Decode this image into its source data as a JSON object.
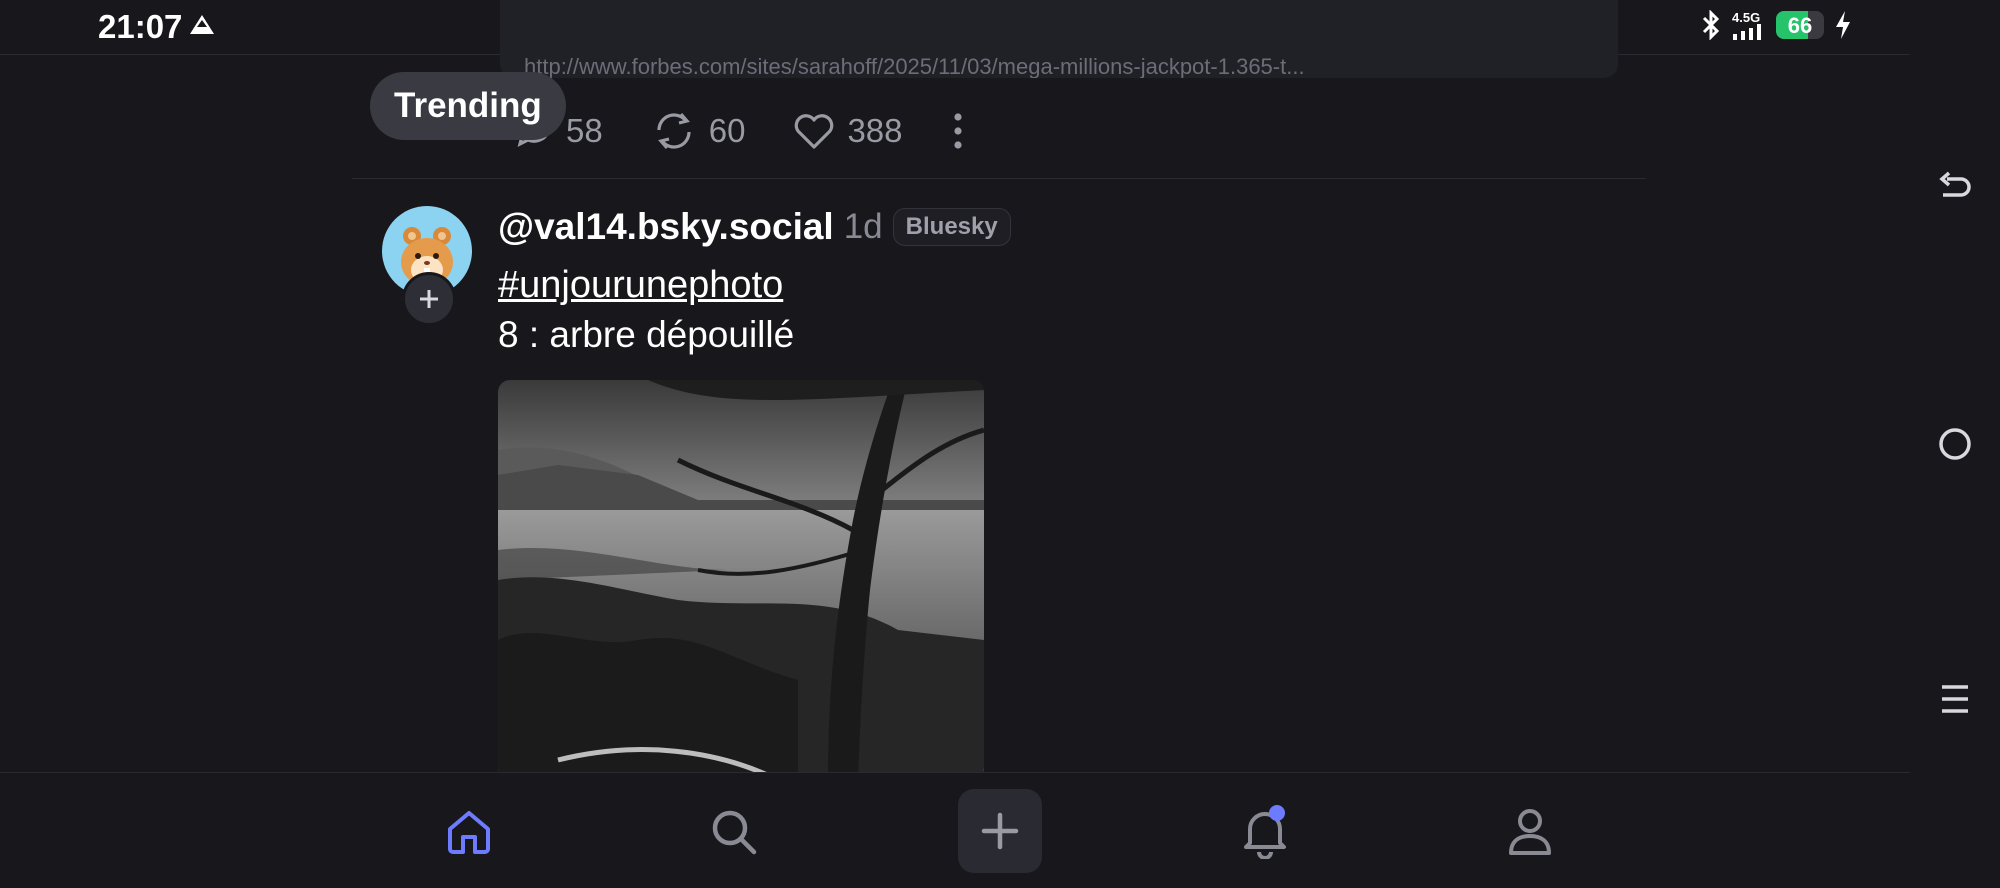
{
  "status_bar": {
    "time": "21:07",
    "network": "4.5G",
    "battery_level": "66",
    "battery_fraction": 0.66,
    "battery_color": "#25c36a"
  },
  "previous_post": {
    "link_url": "http://www.forbes.com/sites/sarahoff/2025/11/03/mega-millions-jackpot-1.365-t...",
    "replies": "58",
    "reposts": "60",
    "likes": "388"
  },
  "tooltip": "Trending",
  "post": {
    "handle": "@val14.bsky.social",
    "age": "1d",
    "platform": "Bluesky",
    "hashtag": "#unjourunephoto",
    "text": "8 : arbre dépouillé",
    "image_icon": "landscape-photo"
  },
  "nav": {
    "active_color": "#6d7cff",
    "icons": [
      "home-icon",
      "search-icon",
      "plus-icon",
      "bell-icon",
      "profile-icon"
    ]
  },
  "system_nav": [
    "back-icon",
    "home-circle-icon",
    "menu-icon"
  ]
}
